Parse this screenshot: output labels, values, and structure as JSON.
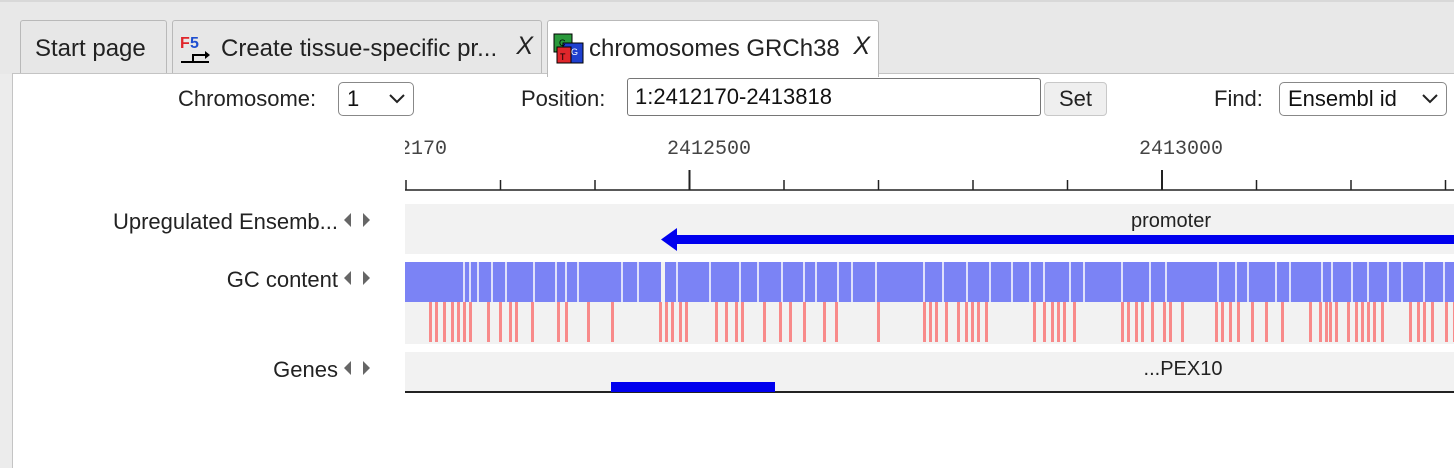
{
  "tabs": [
    {
      "label": "Start page"
    },
    {
      "label": "Create tissue-specific pr...",
      "close": "X",
      "icon": "f5-icon"
    },
    {
      "label": "chromosomes GRCh38",
      "close": "X",
      "icon": "genome-icon"
    }
  ],
  "toolbar": {
    "chromosome_label": "Chromosome:",
    "chromosome_value": "1",
    "position_label": "Position:",
    "position_value": "1:2412170-2413818",
    "set_label": "Set",
    "find_label": "Find:",
    "find_value": "Ensembl id"
  },
  "ruler": {
    "tick_labels": [
      "2170",
      "2412500",
      "2413000"
    ]
  },
  "tracks": [
    {
      "label": "Upregulated Ensemb...",
      "annotation": "promoter"
    },
    {
      "label": "GC content"
    },
    {
      "label": "Genes",
      "annotation": "...PEX10"
    }
  ],
  "colors": {
    "feature_blue": "#0000ee",
    "gc_blue": "#7b83f5",
    "gc_red": "#f88a8a",
    "track_bg": "#f2f2f2"
  }
}
